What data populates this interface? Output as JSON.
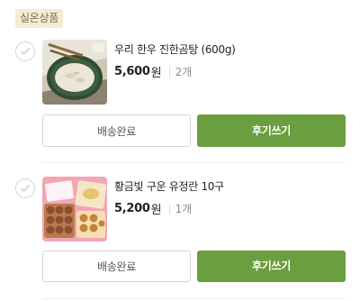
{
  "section": {
    "badge": "실온상품"
  },
  "items": [
    {
      "name": "우리 한우 진한곰탕 (600g)",
      "price": "5,600",
      "currency": "원",
      "quantity": "2개",
      "thumbnail_icon": "beef-soup-bowl-image",
      "actions": {
        "delivered_label": "배송완료",
        "review_label": "후기쓰기"
      }
    },
    {
      "name": "황금빛 구운 유정란 10구",
      "price": "5,200",
      "currency": "원",
      "quantity": "1개",
      "thumbnail_icon": "roasted-eggs-image",
      "actions": {
        "delivered_label": "배송완료",
        "review_label": "후기쓰기"
      }
    }
  ],
  "colors": {
    "review_button": "#6b9e3f",
    "badge_bg": "#f4ecd8",
    "badge_text": "#8a6d3b"
  }
}
